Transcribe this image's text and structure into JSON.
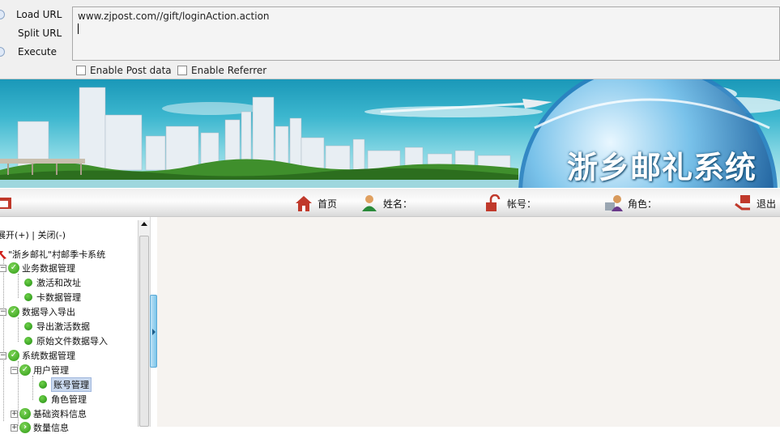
{
  "hackbar": {
    "load_url_label": "Load URL",
    "split_url_label": "Split URL",
    "execute_label": "Execute",
    "url_value": "www.zjpost.com//gift/loginAction.action",
    "enable_post_label": "Enable Post data",
    "enable_referrer_label": "Enable Referrer"
  },
  "banner": {
    "title": "浙乡邮礼系统"
  },
  "navbar": {
    "home_label": "首页",
    "name_label": "姓名：",
    "account_label": "帐号：",
    "role_label": "角色：",
    "logout_label": "退出"
  },
  "tree": {
    "expand_collapse": "展开(+) | 关闭(-)",
    "root_label": "\"浙乡邮礼\"村邮季卡系统",
    "nodes": [
      {
        "label": "业务数据管理"
      },
      {
        "label": "激活和改址"
      },
      {
        "label": "卡数据管理"
      },
      {
        "label": "数据导入导出"
      },
      {
        "label": "导出激活数据"
      },
      {
        "label": "原始文件数据导入"
      },
      {
        "label": "系统数据管理"
      },
      {
        "label": "用户管理"
      },
      {
        "label": "账号管理"
      },
      {
        "label": "角色管理"
      },
      {
        "label": "基础资料信息"
      },
      {
        "label": "数量信息"
      }
    ]
  },
  "colors": {
    "banner_sky": "#3db7cf",
    "tree_node_green": "#2f9a16",
    "selected_bg": "#c9d8ee",
    "content_bg": "#f6f3f0"
  }
}
